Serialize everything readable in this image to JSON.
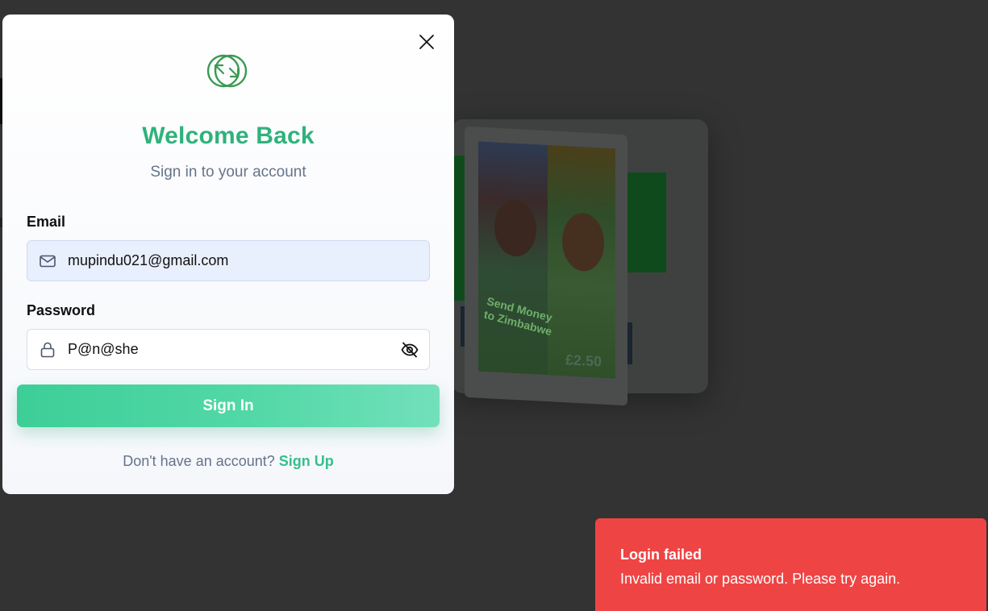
{
  "modal": {
    "title": "Welcome Back",
    "subtitle": "Sign in to your account",
    "email": {
      "label": "Email",
      "value": "mupindu021@gmail.com",
      "icon": "mail-icon"
    },
    "password": {
      "label": "Password",
      "value": "P@n@she",
      "icon": "lock-icon",
      "toggle_icon": "eye-off-icon"
    },
    "submit_label": "Sign In",
    "footer": {
      "prompt": "Don't have an account?",
      "link_label": "Sign Up"
    },
    "close_icon": "close-icon",
    "logo_icon": "exchange-logo-icon"
  },
  "background": {
    "banner_text": "Send Money to Zimbabwe",
    "price_text": "£2.50"
  },
  "toast": {
    "title": "Login failed",
    "message": "Invalid email or password. Please try again."
  },
  "colors": {
    "accent": "#2fb27c",
    "button_gradient_start": "#3dce98",
    "button_gradient_end": "#72e0bb",
    "toast_background": "#ef4444",
    "overlay": "#333333"
  }
}
